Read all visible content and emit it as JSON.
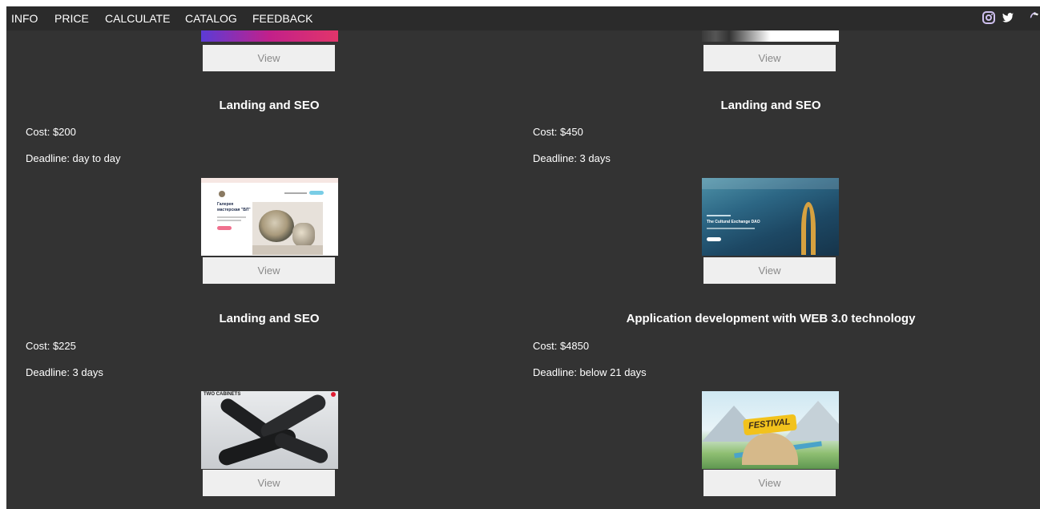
{
  "nav": {
    "items": [
      "INFO",
      "PRICE",
      "CALCULATE",
      "CATALOG",
      "FEEDBACK"
    ],
    "icons": [
      "instagram-icon",
      "twitter-icon",
      "phone-icon"
    ]
  },
  "view_label": "View",
  "cards": [
    {
      "title": "Landing and SEO",
      "cost": "Cost: $200",
      "deadline": "Deadline: day to day"
    },
    {
      "title": "Landing and SEO",
      "cost": "Cost: $450",
      "deadline": "Deadline: 3 days"
    },
    {
      "title": "Landing and SEO",
      "cost": "Cost: $225",
      "deadline": "Deadline: 3 days"
    },
    {
      "title": "Application development with WEB 3.0 technology",
      "cost": "Cost: $4850",
      "deadline": "Deadline: below 21 days"
    }
  ],
  "thumbs": {
    "shop_heading": "Галерея мастерская \"ВЛ\"",
    "exchange_heading": "The Cultural Exchange DAO",
    "brand": "TWO CABINETS",
    "festival": "FESTIVAL"
  },
  "colors": {
    "background": "#333333",
    "nav": "#2b2b2b",
    "button": "#efefef",
    "accent_pink": "#f0708e",
    "accent_blue": "#79cde6"
  }
}
